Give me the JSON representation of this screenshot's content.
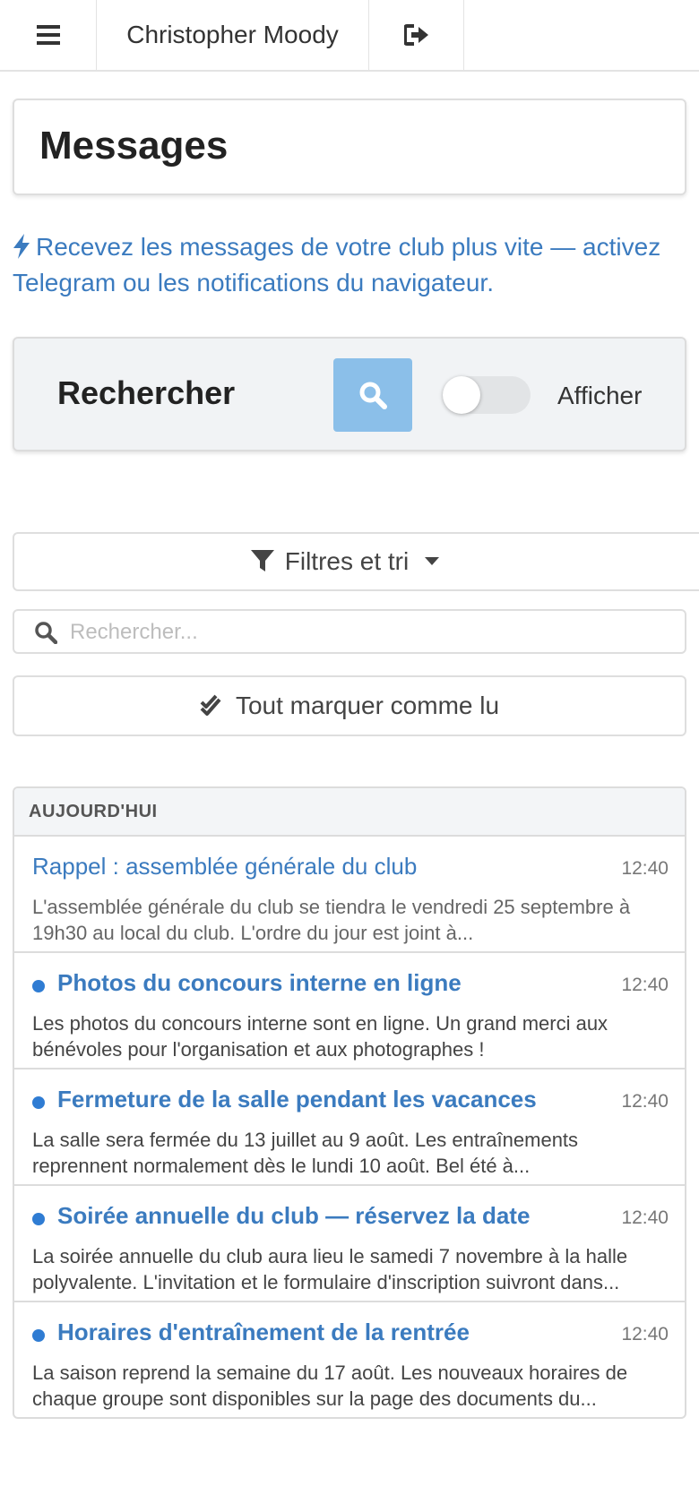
{
  "topbar": {
    "user_name": "Christopher Moody",
    "menu_icon": "hamburger-menu-icon",
    "logout_icon": "sign-out-icon"
  },
  "page": {
    "title": "Messages"
  },
  "notice": {
    "icon": "bolt-icon",
    "text": "Recevez les messages de votre club plus vite — activez Telegram ou les notifications du navigateur."
  },
  "search_panel": {
    "label": "Rechercher",
    "button_icon": "search-icon",
    "toggle_label": "Afficher",
    "toggle_on": false
  },
  "filters": {
    "label": "Filtres et tri",
    "icon": "filter-icon"
  },
  "search": {
    "placeholder": "Rechercher...",
    "value": ""
  },
  "mark_all": {
    "label": "Tout marquer comme lu",
    "icon": "double-check-icon"
  },
  "messages": {
    "group_label": "AUJOURD'HUI",
    "items": [
      {
        "title": "Rappel : assemblée générale du club",
        "time": "12:40",
        "excerpt": "L'assemblée générale du club se tiendra le vendredi 25 septembre à 19h30 au local du club. L'ordre du jour est joint à...",
        "unread": false
      },
      {
        "title": "Photos du concours interne en ligne",
        "time": "12:40",
        "excerpt": "Les photos du concours interne sont en ligne. Un grand merci aux bénévoles pour l'organisation et aux photographes !",
        "unread": true
      },
      {
        "title": "Fermeture de la salle pendant les vacances",
        "time": "12:40",
        "excerpt": "La salle sera fermée du 13 juillet au 9 août. Les entraînements reprennent normalement dès le lundi 10 août. Bel été à...",
        "unread": true
      },
      {
        "title": "Soirée annuelle du club — réservez la date",
        "time": "12:40",
        "excerpt": "La soirée annuelle du club aura lieu le samedi 7 novembre à la halle polyvalente. L'invitation et le formulaire d'inscription suivront dans...",
        "unread": true
      },
      {
        "title": "Horaires d'entraînement de la rentrée",
        "time": "12:40",
        "excerpt": "La saison reprend la semaine du 17 août. Les nouveaux horaires de chaque groupe sont disponibles sur la page des documents du...",
        "unread": true
      }
    ]
  },
  "colors": {
    "accent": "#3b7bbf",
    "unread_dot": "#2f7cd3",
    "search_button": "#8bbfe9"
  }
}
